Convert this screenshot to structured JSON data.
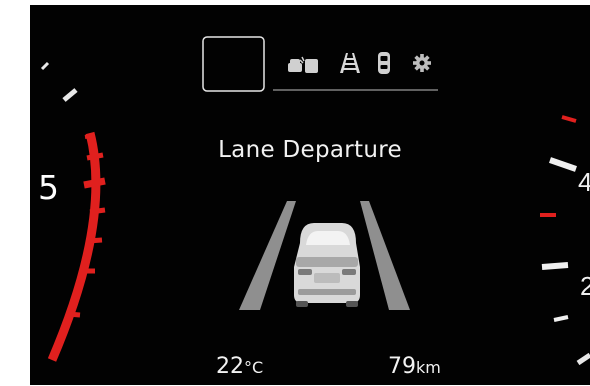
{
  "display": {
    "message": "Lane Departure",
    "gear_indicator": "5",
    "temperature": {
      "value": "22",
      "unit": "°C"
    },
    "distance": {
      "value": "79",
      "unit": "km"
    }
  },
  "top_bar": {
    "icons": [
      "forward-collision-icon",
      "lane-keeping-icon",
      "driver-attention-icon",
      "settings-gear-icon"
    ]
  },
  "colors": {
    "background": "#020202",
    "text": "#f2f2f2",
    "gauge_red": "#e0201e",
    "lane": "#8f8f8f",
    "car": "#d9d9d9"
  }
}
